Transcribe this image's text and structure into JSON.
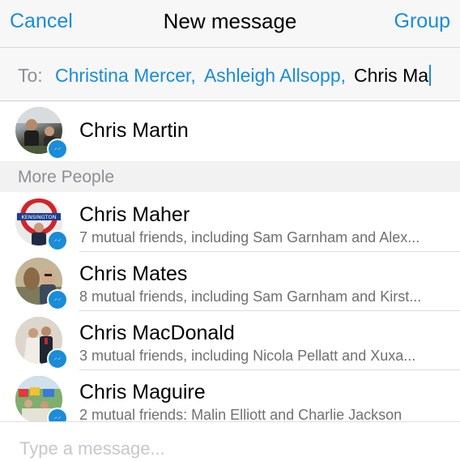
{
  "nav": {
    "cancel_label": "Cancel",
    "title": "New message",
    "group_label": "Group"
  },
  "to": {
    "label": "To:",
    "recipients": [
      "Christina Mercer,",
      "Ashleigh Allsopp,"
    ],
    "typed_text": "Chris Ma"
  },
  "top_result": {
    "name": "Chris Martin",
    "avatar_icon": "avatar-photo",
    "badge_icon": "messenger-icon"
  },
  "section": {
    "title": "More People"
  },
  "people": [
    {
      "name": "Chris Maher",
      "subtitle": "7 mutual friends, including Sam Garnham and Alex..."
    },
    {
      "name": "Chris Mates",
      "subtitle": "8 mutual friends, including Sam Garnham and Kirst..."
    },
    {
      "name": "Chris MacDonald",
      "subtitle": "3 mutual friends, including Nicola Pellatt and Xuxa..."
    },
    {
      "name": "Chris Maguire",
      "subtitle": "2 mutual friends: Malin Elliott and Charlie Jackson"
    }
  ],
  "compose": {
    "placeholder": "Type a message..."
  },
  "colors": {
    "accent": "#1a8cd8",
    "secondary_text": "#8e8e93"
  }
}
